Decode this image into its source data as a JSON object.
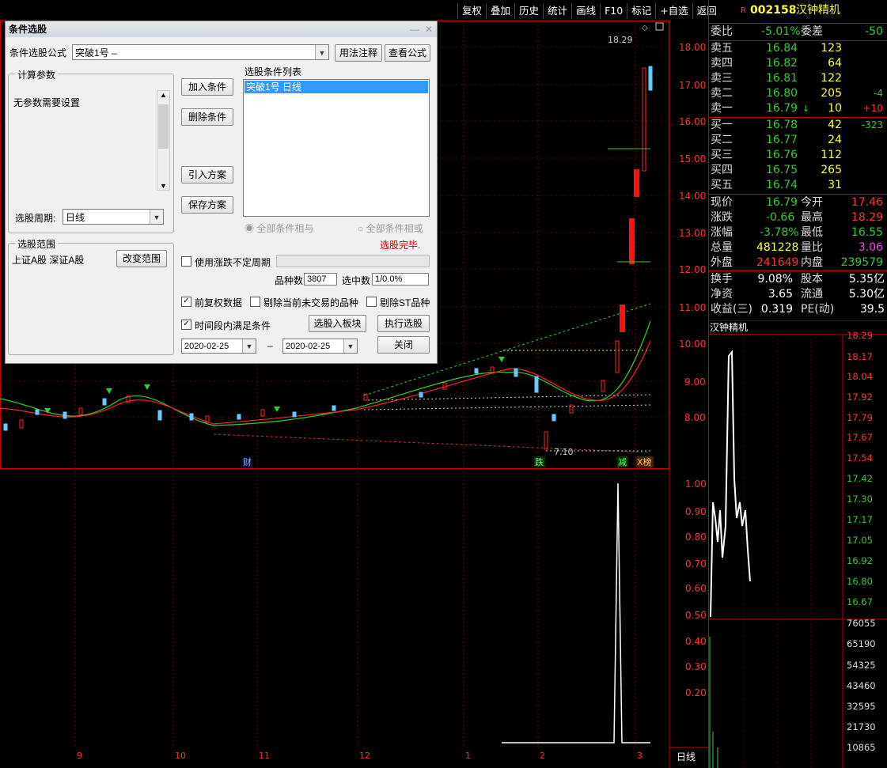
{
  "toolbar": {
    "items": [
      "复权",
      "叠加",
      "历史",
      "统计",
      "画线",
      "F10",
      "标记",
      "+自选",
      "返回"
    ]
  },
  "stock": {
    "code": "002158",
    "name": "汉钟精机",
    "flag": "R"
  },
  "quote": {
    "weibi_label": "委比",
    "weibi": "-5.01%",
    "weicha_label": "委差",
    "weicha": "-50",
    "sell": [
      {
        "label": "卖五",
        "price": "16.84",
        "vol": "123",
        "chg": ""
      },
      {
        "label": "卖四",
        "price": "16.82",
        "vol": "64",
        "chg": ""
      },
      {
        "label": "卖三",
        "price": "16.81",
        "vol": "122",
        "chg": ""
      },
      {
        "label": "卖二",
        "price": "16.80",
        "vol": "205",
        "chg": "-4"
      },
      {
        "label": "卖一",
        "price": "16.79",
        "vol": "10",
        "chg": "+10"
      }
    ],
    "buy": [
      {
        "label": "买一",
        "price": "16.78",
        "vol": "42",
        "chg": "-323"
      },
      {
        "label": "买二",
        "price": "16.77",
        "vol": "24",
        "chg": ""
      },
      {
        "label": "买三",
        "price": "16.76",
        "vol": "112",
        "chg": ""
      },
      {
        "label": "买四",
        "price": "16.75",
        "vol": "265",
        "chg": ""
      },
      {
        "label": "买五",
        "price": "16.74",
        "vol": "31",
        "chg": ""
      }
    ],
    "stats": [
      {
        "l1": "现价",
        "v1": "16.79",
        "c1": "grn",
        "l2": "今开",
        "v2": "17.46",
        "c2": "red"
      },
      {
        "l1": "涨跌",
        "v1": "-0.66",
        "c1": "grn",
        "l2": "最高",
        "v2": "18.29",
        "c2": "red"
      },
      {
        "l1": "涨幅",
        "v1": "-3.78%",
        "c1": "grn",
        "l2": "最低",
        "v2": "16.55",
        "c2": "grn"
      },
      {
        "l1": "总量",
        "v1": "481228",
        "c1": "yel",
        "l2": "量比",
        "v2": "3.06",
        "c2": "mag"
      },
      {
        "l1": "外盘",
        "v1": "241649",
        "c1": "red",
        "l2": "内盘",
        "v2": "239579",
        "c2": "grn"
      }
    ],
    "stats2": [
      {
        "l1": "换手",
        "v1": "9.08%",
        "l2": "股本",
        "v2": "5.35亿"
      },
      {
        "l1": "净资",
        "v1": "3.65",
        "l2": "流通",
        "v2": "5.30亿"
      },
      {
        "l1": "收益(三)",
        "v1": "0.319",
        "l2": "PE(动)",
        "v2": "39.5"
      }
    ]
  },
  "intraday": {
    "title": "汉钟精机",
    "price_ticks": [
      "18.29",
      "18.17",
      "18.04",
      "17.92",
      "17.79",
      "17.67",
      "17.54",
      "17.42",
      "17.30",
      "17.17",
      "17.05",
      "16.92",
      "16.80",
      "16.67"
    ],
    "vol_ticks": [
      "76055",
      "65190",
      "54325",
      "43460",
      "32595",
      "21730",
      "10865"
    ]
  },
  "kline": {
    "price_axis": [
      "18.00",
      "17.00",
      "16.00",
      "15.00",
      "14.00",
      "13.00",
      "12.00",
      "11.00",
      "10.00",
      "9.00",
      "8.00"
    ],
    "ind_axis": [
      "1.00",
      "0.90",
      "0.80",
      "0.70",
      "0.60",
      "0.50",
      "0.40",
      "0.30",
      "0.20"
    ],
    "months": [
      "9",
      "10",
      "11",
      "12",
      "1",
      "2",
      "3"
    ],
    "labels": {
      "high": "18.29",
      "low": "7.10",
      "cai": "财",
      "die": "跌",
      "jian": "减",
      "xx": "X榜"
    },
    "period": "日线"
  },
  "dialog": {
    "title": "条件选股",
    "formula_label": "条件选股公式",
    "formula_value": "突破1号           –",
    "usage_btn": "用法注释",
    "view_btn": "查看公式",
    "params_title": "计算参数",
    "params_text": "无参数需要设置",
    "period_label": "选股周期:",
    "period_value": "日线",
    "range_title": "选股范围",
    "range_text": "上证A股  深证A股",
    "change_range_btn": "改变范围",
    "add_btn": "加入条件",
    "del_btn": "删除条件",
    "import_btn": "引入方案",
    "save_btn": "保存方案",
    "list_title": "选股条件列表",
    "list_item": "突破1号   日线",
    "radio_and": "全部条件相与",
    "radio_or": "全部条件相或",
    "done_text": "选股完毕.",
    "uncertain_label": "使用涨跌不定周期",
    "count_label": "品种数",
    "count_value": "3807",
    "selected_label": "选中数",
    "selected_value": "1/0.0%",
    "fq_label": "前复权数据",
    "skip_untraded_label": "剔除当前未交易的品种",
    "skip_st_label": "剔除ST品种",
    "time_label": "时间段内满足条件",
    "to_board_btn": "选股入板块",
    "run_btn": "执行选股",
    "date_from": "2020-02-25",
    "date_to": "2020-02-25",
    "dash": "–",
    "close_btn": "关闭"
  }
}
